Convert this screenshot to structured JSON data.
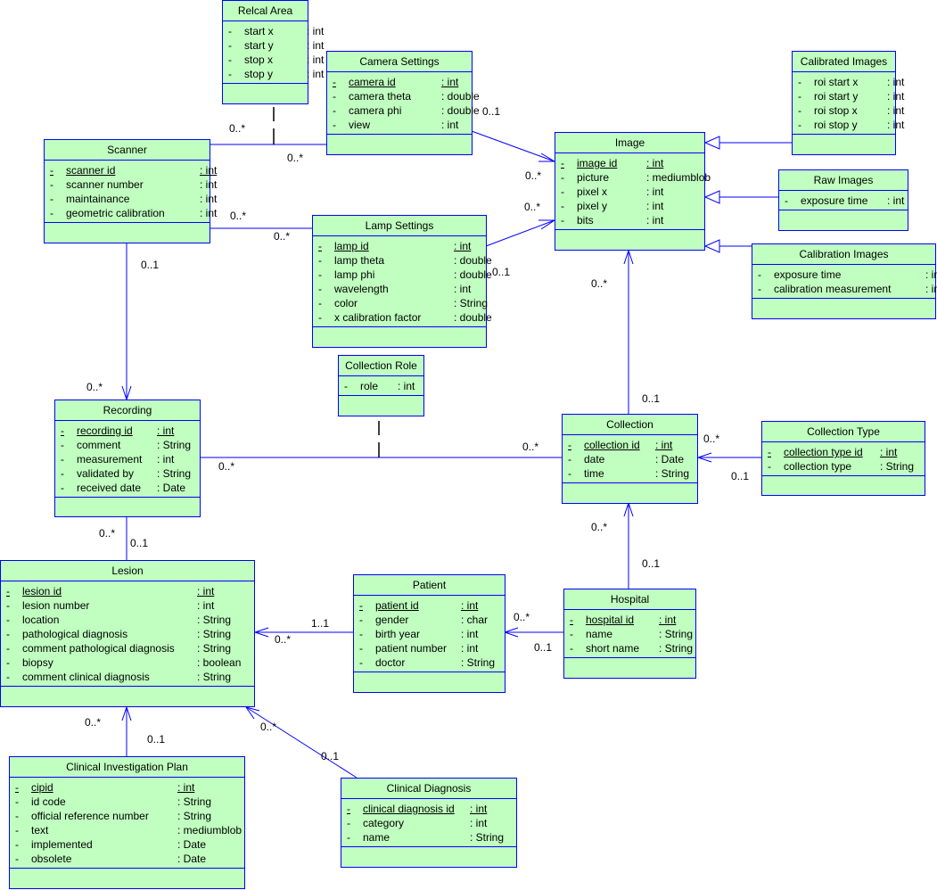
{
  "classes": {
    "relcal_area": {
      "name": "Relcal Area",
      "attrs": [
        {
          "vis": "-",
          "name": "start x",
          "type": ": int"
        },
        {
          "vis": "-",
          "name": "start y",
          "type": ": int"
        },
        {
          "vis": "-",
          "name": "stop x",
          "type": ": int"
        },
        {
          "vis": "-",
          "name": "stop y",
          "type": ": int"
        }
      ]
    },
    "camera_settings": {
      "name": "Camera Settings",
      "attrs": [
        {
          "vis": "-",
          "name": "camera id",
          "type": ": int",
          "pk": true
        },
        {
          "vis": "-",
          "name": "camera theta",
          "type": ": double"
        },
        {
          "vis": "-",
          "name": "camera phi",
          "type": ": double"
        },
        {
          "vis": "-",
          "name": "view",
          "type": ": int"
        }
      ]
    },
    "scanner": {
      "name": "Scanner",
      "attrs": [
        {
          "vis": "-",
          "name": "scanner id",
          "type": ": int",
          "pk": true
        },
        {
          "vis": "-",
          "name": "scanner number",
          "type": ": int"
        },
        {
          "vis": "-",
          "name": "maintainance",
          "type": ": int"
        },
        {
          "vis": "-",
          "name": "geometric calibration",
          "type": ": int"
        }
      ]
    },
    "lamp_settings": {
      "name": "Lamp Settings",
      "attrs": [
        {
          "vis": "-",
          "name": "lamp id",
          "type": ": int",
          "pk": true
        },
        {
          "vis": "-",
          "name": "lamp theta",
          "type": ": double"
        },
        {
          "vis": "-",
          "name": "lamp phi",
          "type": ": double"
        },
        {
          "vis": "-",
          "name": "wavelength",
          "type": ": int"
        },
        {
          "vis": "-",
          "name": "color",
          "type": ": String"
        },
        {
          "vis": "-",
          "name": "x calibration factor",
          "type": ": double"
        }
      ]
    },
    "image": {
      "name": "Image",
      "attrs": [
        {
          "vis": "-",
          "name": "image id",
          "type": ": int",
          "pk": true
        },
        {
          "vis": "-",
          "name": "picture",
          "type": ": mediumblob"
        },
        {
          "vis": "-",
          "name": "pixel x",
          "type": ": int"
        },
        {
          "vis": "-",
          "name": "pixel y",
          "type": ": int"
        },
        {
          "vis": "-",
          "name": "bits",
          "type": ": int"
        }
      ]
    },
    "calibrated_images": {
      "name": "Calibrated Images",
      "attrs": [
        {
          "vis": "-",
          "name": "roi start x",
          "type": ": int"
        },
        {
          "vis": "-",
          "name": "roi start y",
          "type": ": int"
        },
        {
          "vis": "-",
          "name": "roi stop x",
          "type": ": int"
        },
        {
          "vis": "-",
          "name": "roi stop y",
          "type": ": int"
        }
      ]
    },
    "raw_images": {
      "name": "Raw Images",
      "attrs": [
        {
          "vis": "-",
          "name": "exposure time",
          "type": ": int"
        }
      ]
    },
    "calibration_images": {
      "name": "Calibration Images",
      "attrs": [
        {
          "vis": "-",
          "name": "exposure time",
          "type": ": int"
        },
        {
          "vis": "-",
          "name": "calibration measurement",
          "type": ": int"
        }
      ]
    },
    "collection_role": {
      "name": "Collection Role",
      "attrs": [
        {
          "vis": "-",
          "name": "role",
          "type": ": int"
        }
      ]
    },
    "recording": {
      "name": "Recording",
      "attrs": [
        {
          "vis": "-",
          "name": "recording id",
          "type": ": int",
          "pk": true
        },
        {
          "vis": "-",
          "name": "comment",
          "type": ": String"
        },
        {
          "vis": "-",
          "name": "measurement",
          "type": ": int"
        },
        {
          "vis": "-",
          "name": "validated by",
          "type": ": String"
        },
        {
          "vis": "-",
          "name": "received date",
          "type": ": Date"
        }
      ]
    },
    "collection": {
      "name": "Collection",
      "attrs": [
        {
          "vis": "-",
          "name": "collection id",
          "type": ": int",
          "pk": true
        },
        {
          "vis": "-",
          "name": "date",
          "type": ": Date"
        },
        {
          "vis": "-",
          "name": "time",
          "type": ": String"
        }
      ]
    },
    "collection_type": {
      "name": "Collection Type",
      "attrs": [
        {
          "vis": "-",
          "name": "collection type id",
          "type": ": int",
          "pk": true
        },
        {
          "vis": "-",
          "name": "collection type",
          "type": ": String"
        }
      ]
    },
    "lesion": {
      "name": "Lesion",
      "attrs": [
        {
          "vis": "-",
          "name": "lesion id",
          "type": ": int",
          "pk": true
        },
        {
          "vis": "-",
          "name": "lesion number",
          "type": ": int"
        },
        {
          "vis": "-",
          "name": "location",
          "type": ": String"
        },
        {
          "vis": "-",
          "name": "pathological diagnosis",
          "type": ": String"
        },
        {
          "vis": "-",
          "name": "comment pathological diagnosis",
          "type": ": String"
        },
        {
          "vis": "-",
          "name": "biopsy",
          "type": ": boolean"
        },
        {
          "vis": "-",
          "name": "comment clinical diagnosis",
          "type": ": String"
        }
      ]
    },
    "patient": {
      "name": "Patient",
      "attrs": [
        {
          "vis": "-",
          "name": "patient id",
          "type": ": int",
          "pk": true
        },
        {
          "vis": "-",
          "name": "gender",
          "type": ": char"
        },
        {
          "vis": "-",
          "name": "birth year",
          "type": ": int"
        },
        {
          "vis": "-",
          "name": "patient number",
          "type": ": int"
        },
        {
          "vis": "-",
          "name": "doctor",
          "type": ": String"
        }
      ]
    },
    "hospital": {
      "name": "Hospital",
      "attrs": [
        {
          "vis": "-",
          "name": "hospital id",
          "type": ": int",
          "pk": true
        },
        {
          "vis": "-",
          "name": "name",
          "type": ": String"
        },
        {
          "vis": "-",
          "name": "short name",
          "type": ": String"
        }
      ]
    },
    "clinical_investigation_plan": {
      "name": "Clinical Investigation Plan",
      "attrs": [
        {
          "vis": "-",
          "name": "cipid",
          "type": ": int",
          "pk": true
        },
        {
          "vis": "-",
          "name": "id code",
          "type": ": String"
        },
        {
          "vis": "-",
          "name": "official reference number",
          "type": ": String"
        },
        {
          "vis": "-",
          "name": "text",
          "type": ": mediumblob"
        },
        {
          "vis": "-",
          "name": "implemented",
          "type": ": Date"
        },
        {
          "vis": "-",
          "name": "obsolete",
          "type": ": Date"
        }
      ]
    },
    "clinical_diagnosis": {
      "name": "Clinical Diagnosis",
      "attrs": [
        {
          "vis": "-",
          "name": "clinical diagnosis id",
          "type": ": int",
          "pk": true
        },
        {
          "vis": "-",
          "name": "category",
          "type": ": int"
        },
        {
          "vis": "-",
          "name": "name",
          "type": ": String"
        }
      ]
    }
  },
  "multiplicities": {
    "scanner_camera_a": "0..*",
    "scanner_camera_b": "0..*",
    "camera_image_a": "0..1",
    "camera_image_b": "0..*",
    "scanner_lamp_a": "0..*",
    "scanner_lamp_b": "0..*",
    "lamp_image_a": "0..1",
    "lamp_image_b": "0..*",
    "scanner_recording_a": "0..1",
    "scanner_recording_b": "0..*",
    "image_collection_a": "0..*",
    "image_collection_b": "0..1",
    "recording_collection_a": "0..*",
    "recording_collection_b": "0..*",
    "colltype_collection_a": "0..*",
    "colltype_collection_b": "0..1",
    "recording_lesion_a": "0..*",
    "recording_lesion_b": "0..1",
    "hospital_collection_a": "0..*",
    "hospital_collection_b": "0..1",
    "patient_lesion_a": "1..1",
    "patient_lesion_b": "0..*",
    "hospital_patient_a": "0..*",
    "hospital_patient_b": "0..1",
    "cip_lesion_a": "0..*",
    "cip_lesion_b": "0..1",
    "diag_lesion_a": "0..*",
    "diag_lesion_b": "0..1"
  },
  "colors": {
    "class_fill": "#c0ffc0",
    "class_border": "#0000ff",
    "line": "#0000ff"
  }
}
